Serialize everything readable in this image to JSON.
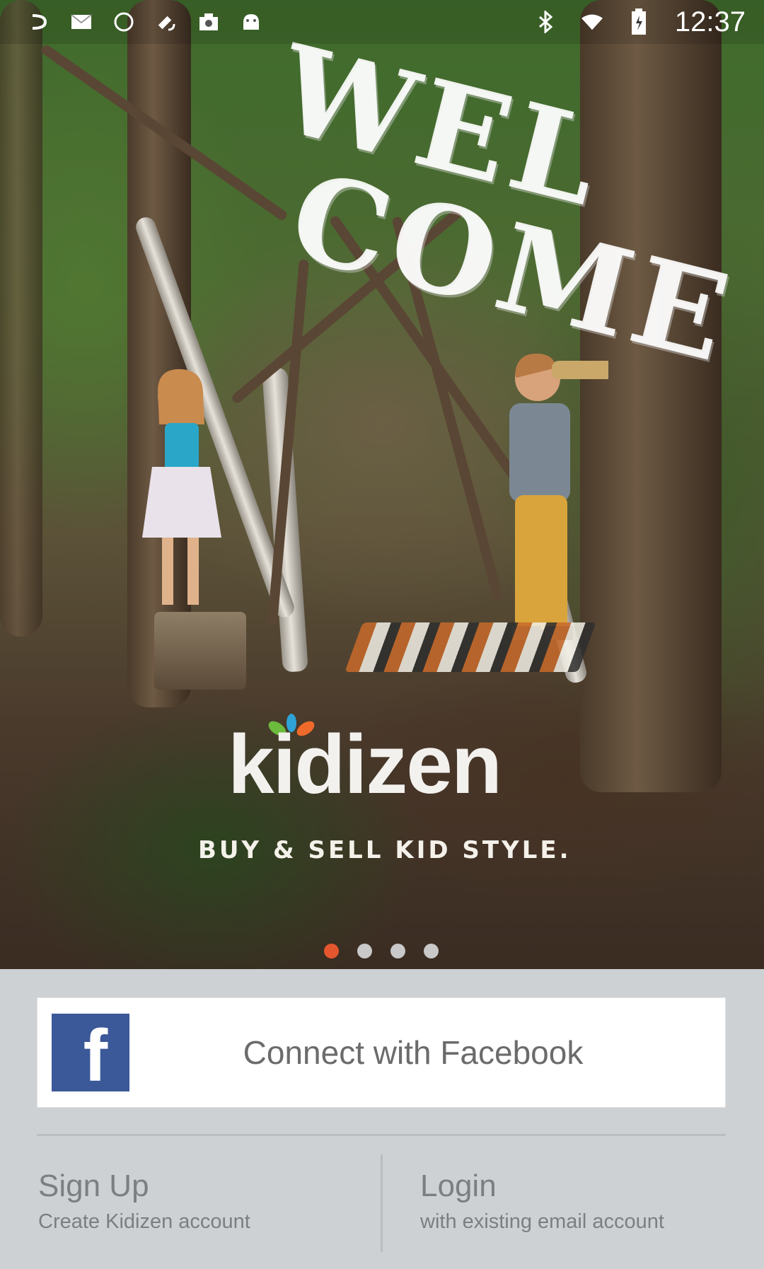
{
  "status_bar": {
    "left_icons": [
      "notification-icon",
      "mail-icon",
      "circle-icon",
      "satellite-icon",
      "camera-icon",
      "android-icon"
    ],
    "right_icons": [
      "bluetooth-icon",
      "wifi-icon",
      "battery-icon"
    ],
    "time": "12:37"
  },
  "hero": {
    "overlay_text_line1": "WEL",
    "overlay_text_line2": "COME",
    "logo_text": "kidizen",
    "tagline": "BUY & SELL KID STYLE.",
    "pager": {
      "count": 4,
      "active_index": 0,
      "accent": "#e4572e"
    }
  },
  "facebook_button": {
    "icon_glyph": "f",
    "label": "Connect with Facebook",
    "brand_color": "#3b5998"
  },
  "signup": {
    "title": "Sign Up",
    "subtitle": "Create Kidizen account"
  },
  "login": {
    "title": "Login",
    "subtitle": "with existing email account"
  }
}
